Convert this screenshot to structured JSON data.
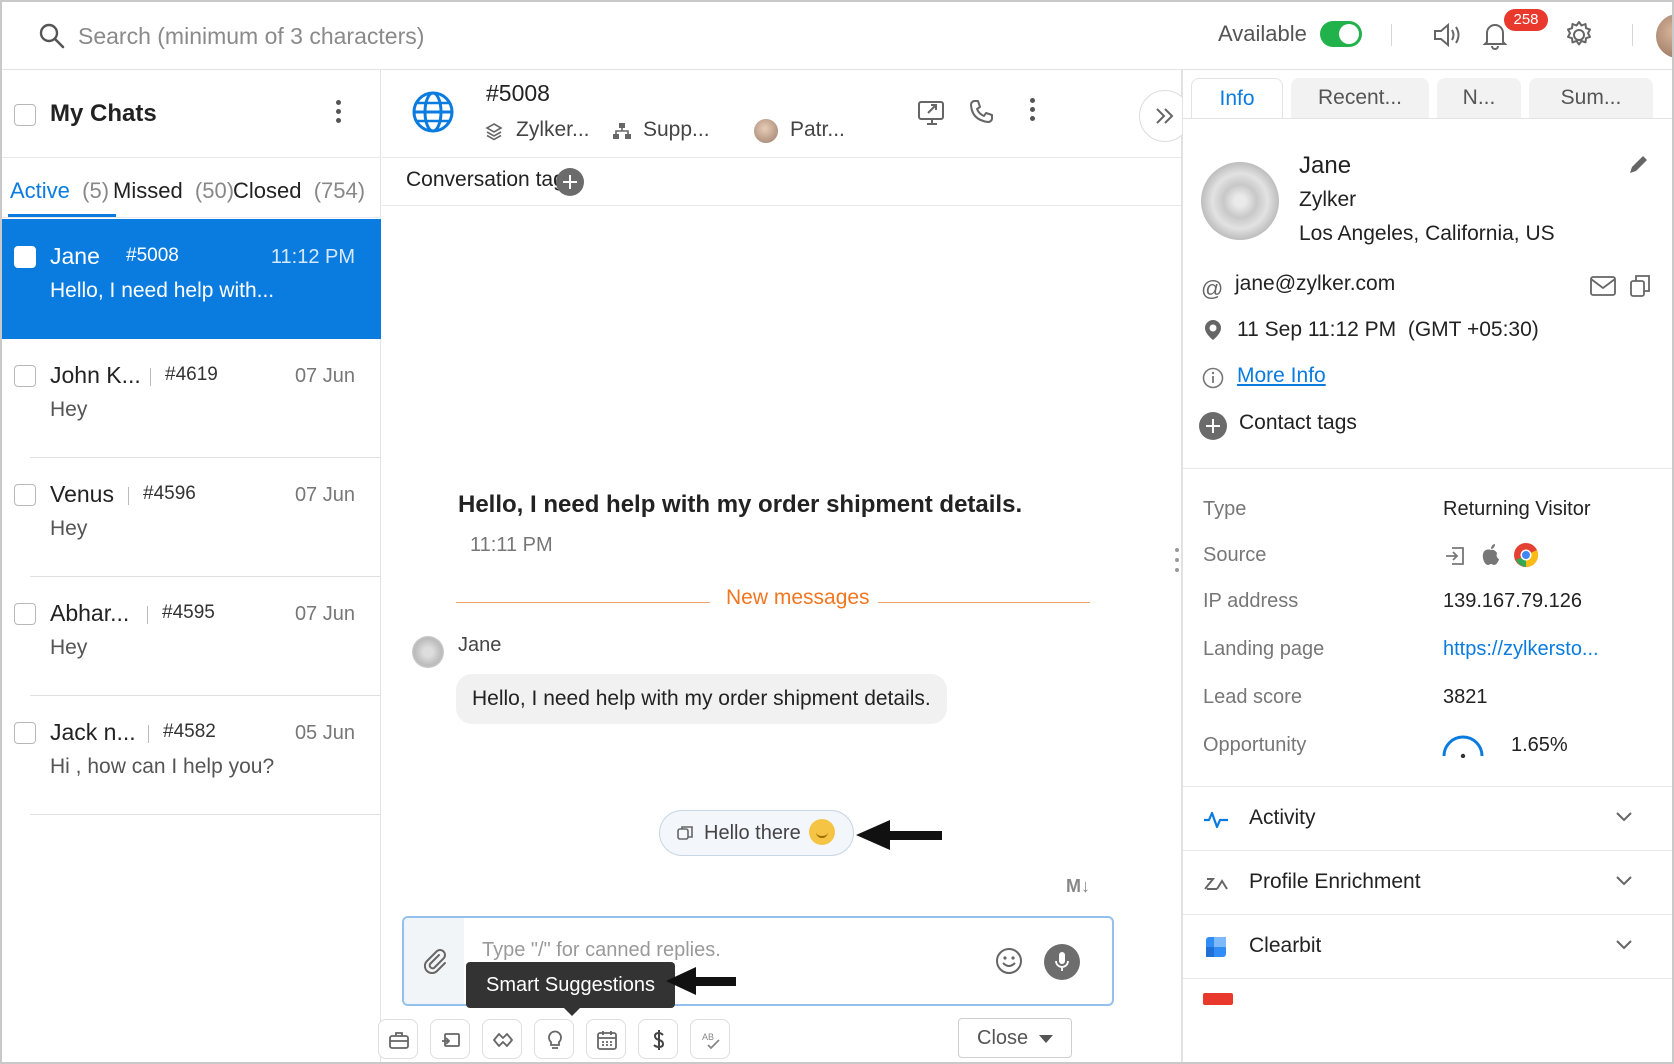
{
  "topbar": {
    "search_placeholder": "Search (minimum of 3 characters)",
    "availability_label": "Available",
    "availability_on": true,
    "notification_count": "258"
  },
  "sidebar": {
    "title": "My Chats",
    "tabs": [
      {
        "label": "Active",
        "count": "(5)"
      },
      {
        "label": "Missed",
        "count": "(50)"
      },
      {
        "label": "Closed",
        "count": "(754)"
      }
    ],
    "chats": [
      {
        "name": "Jane",
        "id": "#5008",
        "time": "11:12 PM",
        "message": "Hello, I need help with...",
        "selected": true
      },
      {
        "name": "John K...",
        "id": "#4619",
        "time": "07 Jun",
        "message": "Hey",
        "selected": false
      },
      {
        "name": "Venus",
        "id": "#4596",
        "time": "07 Jun",
        "message": "Hey",
        "selected": false
      },
      {
        "name": "Abhar...",
        "id": "#4595",
        "time": "07 Jun",
        "message": "Hey",
        "selected": false
      },
      {
        "name": "Jack n...",
        "id": "#4582",
        "time": "05 Jun",
        "message": "Hi , how can I help you?",
        "selected": false
      }
    ]
  },
  "conversation": {
    "id": "#5008",
    "brand": "Zylker...",
    "department": "Supp...",
    "agent": "Patr...",
    "tags_label": "Conversation tags",
    "first_message": "Hello, I need help with my order shipment details.",
    "first_time": "11:11 PM",
    "new_messages_label": "New messages",
    "sender": "Jane",
    "message": "Hello, I need help with my order shipment details.",
    "suggestion": "Hello there",
    "composer_placeholder": "Type \"/\" for canned replies.",
    "tooltip": "Smart Suggestions",
    "close_label": "Close",
    "markdown_label": "M↓"
  },
  "panel": {
    "tabs": [
      "Info",
      "Recent...",
      "N...",
      "Sum..."
    ],
    "contact": {
      "name": "Jane",
      "company": "Zylker",
      "location": "Los Angeles, California, US",
      "email": "jane@zylker.com",
      "local_time": "11 Sep 11:12 PM",
      "timezone": "(GMT +05:30)",
      "more_info": "More Info",
      "contact_tags": "Contact tags"
    },
    "properties": [
      {
        "label": "Type",
        "value": "Returning Visitor"
      },
      {
        "label": "Source",
        "value": ""
      },
      {
        "label": "IP address",
        "value": "139.167.79.126"
      },
      {
        "label": "Landing page",
        "value": "https://zylkersto..."
      },
      {
        "label": "Lead score",
        "value": "3821"
      },
      {
        "label": "Opportunity",
        "value": "1.65%"
      }
    ],
    "sections": [
      "Activity",
      "Profile Enrichment",
      "Clearbit"
    ]
  },
  "colors": {
    "accent": "#0a7ce0",
    "toggle_on": "#21b24b",
    "badge": "#e8392c",
    "new_messages": "#f2761f"
  }
}
